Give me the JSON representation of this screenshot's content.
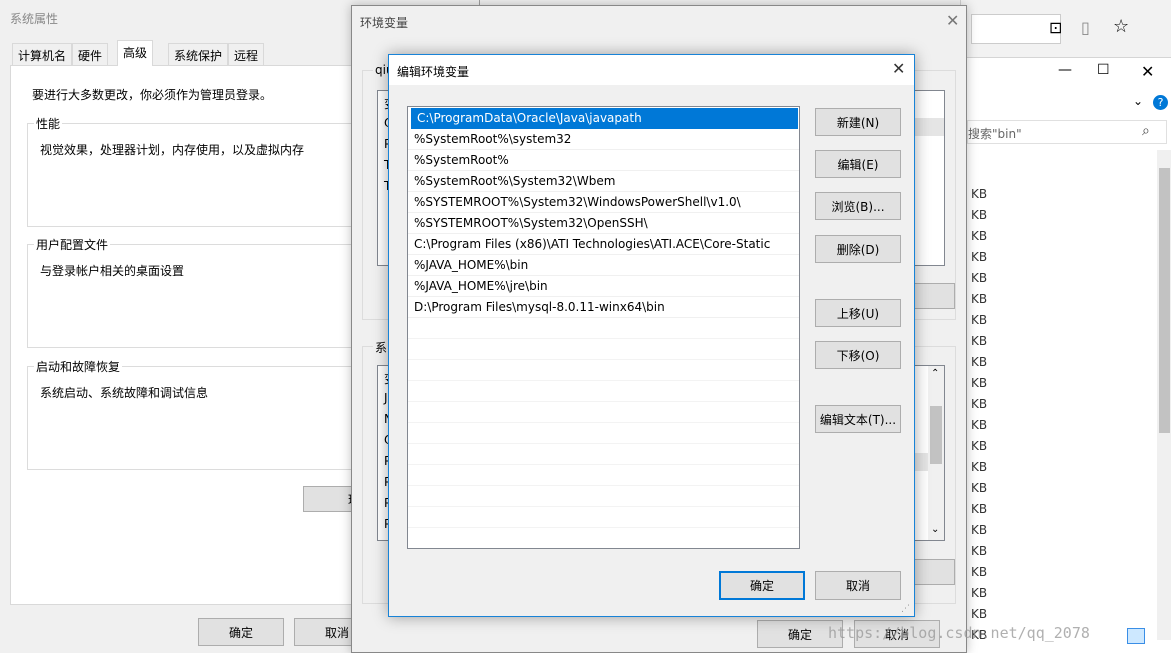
{
  "sysprops": {
    "title": "系统属性",
    "tabs": [
      "计算机名",
      "硬件",
      "高级",
      "系统保护",
      "远程"
    ],
    "admin_note": "要进行大多数更改，你必须作为管理员登录。",
    "perf_title": "性能",
    "perf_desc": "视觉效果，处理器计划，内存使用，以及虚拟内存",
    "profile_title": "用户配置文件",
    "profile_desc": "与登录帐户相关的桌面设置",
    "startup_title": "启动和故障恢复",
    "startup_desc": "系统启动、系统故障和调试信息",
    "env_btn": "环",
    "ok": "确定",
    "cancel": "取消"
  },
  "envvars": {
    "title": "环境变量",
    "user_group": "qiu",
    "sys_group": "系",
    "user_rows": [
      "变",
      "O",
      "P",
      "T",
      "T"
    ],
    "sys_rows": [
      "变",
      "J",
      "N",
      "O",
      "P",
      "P",
      "P",
      "P"
    ],
    "ok": "确定",
    "cancel": "取消"
  },
  "edit": {
    "title": "编辑环境变量",
    "paths": [
      "C:\\ProgramData\\Oracle\\Java\\javapath",
      "%SystemRoot%\\system32",
      "%SystemRoot%",
      "%SystemRoot%\\System32\\Wbem",
      "%SYSTEMROOT%\\System32\\WindowsPowerShell\\v1.0\\",
      "%SYSTEMROOT%\\System32\\OpenSSH\\",
      "C:\\Program Files (x86)\\ATI Technologies\\ATI.ACE\\Core-Static",
      "%JAVA_HOME%\\bin",
      "%JAVA_HOME%\\jre\\bin",
      "D:\\Program Files\\mysql-8.0.11-winx64\\bin"
    ],
    "buttons": {
      "new": "新建(N)",
      "edit": "编辑(E)",
      "browse": "浏览(B)...",
      "delete": "删除(D)",
      "up": "上移(U)",
      "down": "下移(O)",
      "edit_text": "编辑文本(T)..."
    },
    "ok": "确定",
    "cancel": "取消"
  },
  "explorer": {
    "search_placeholder": "搜索\"bin\"",
    "size_unit": "KB",
    "size_rows": 22
  },
  "watermark": "https://blog.csdn.net/qq_2078",
  "colors": {
    "selection": "#0078d7",
    "accent_border": "#0078d7",
    "window_bg": "#f0f0f0"
  }
}
